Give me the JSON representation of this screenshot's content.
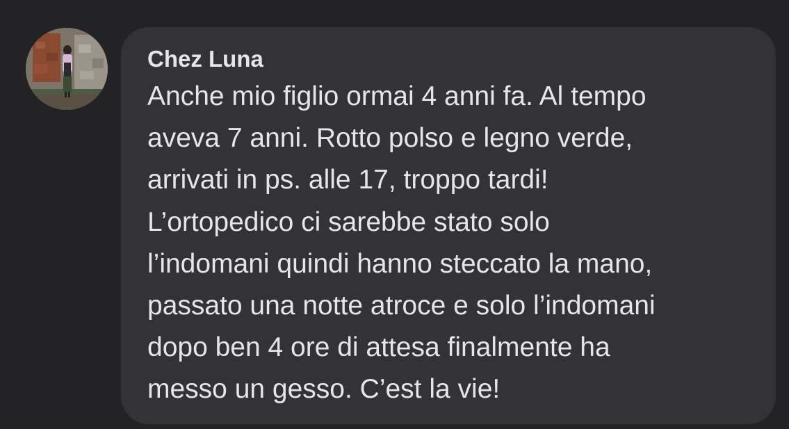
{
  "comment": {
    "author": "Chez Luna",
    "lines": [
      "Anche mio figlio ormai 4 anni fa. Al tempo",
      "aveva 7 anni. Rotto polso e legno verde,",
      "arrivati in ps. alle 17, troppo tardi!",
      "L’ortopedico ci sarebbe stato solo",
      "l’indomani quindi hanno steccato la mano,",
      "passato una notte atroce e solo l’indomani",
      "dopo ben 4 ore di attesa finalmente ha",
      "messo un gesso. C’est la vie!"
    ]
  },
  "colors": {
    "background": "#232325",
    "bubble": "#333336",
    "text": "#e6e6e9"
  }
}
